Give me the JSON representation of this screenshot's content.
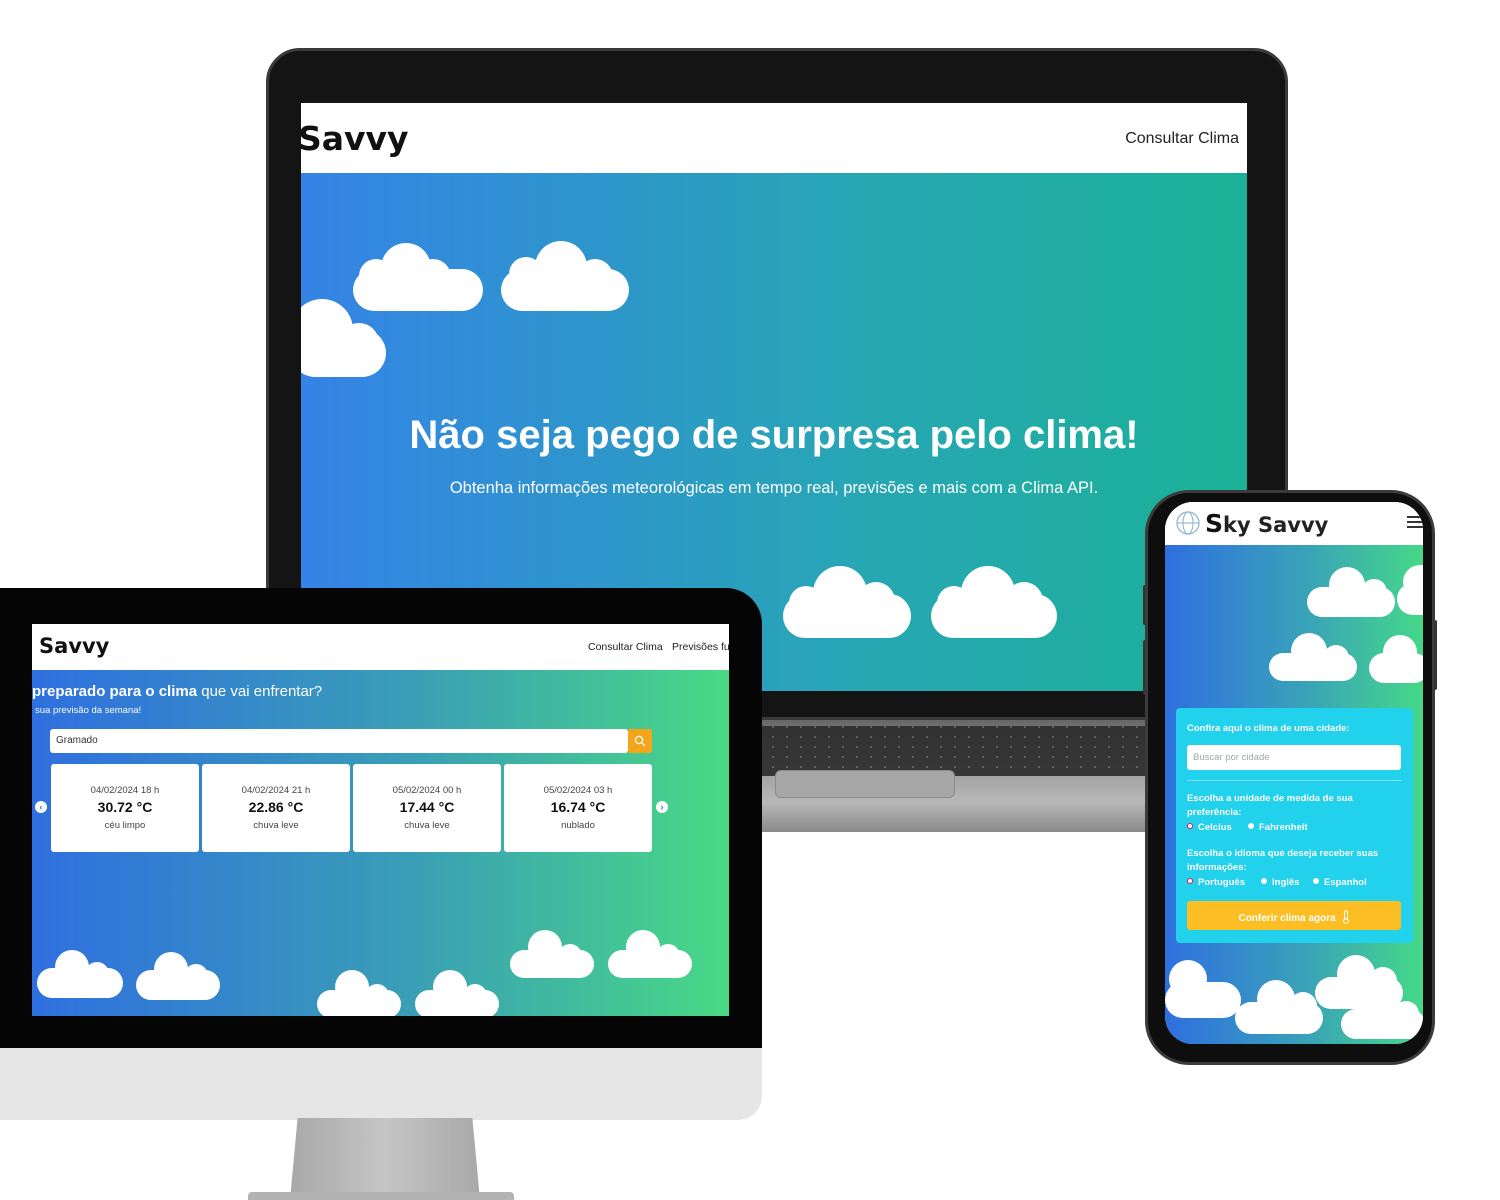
{
  "laptop": {
    "nav": {
      "logo": "Savvy",
      "link": "Consultar Clima"
    },
    "hero": {
      "title": "Não seja pego de surpresa pelo clima!",
      "subtitle": "Obtenha informações meteorológicas em tempo real, previsões e mais com a Clima API."
    }
  },
  "desktop": {
    "nav": {
      "logo": "Savvy",
      "links": [
        "Consultar Clima",
        "Previsões fu"
      ]
    },
    "hero": {
      "heading_bold": "preparado para o clima",
      "heading_rest": " que vai enfrentar?",
      "subtitle": "sua previsão da semana!"
    },
    "search": {
      "value": "Gramado"
    },
    "forecast": [
      {
        "date": "04/02/2024 18 h",
        "temp": "30.72 °C",
        "desc": "céu limpo"
      },
      {
        "date": "04/02/2024 21 h",
        "temp": "22.86 °C",
        "desc": "chuva leve"
      },
      {
        "date": "05/02/2024 00 h",
        "temp": "17.44 °C",
        "desc": "chuva leve"
      },
      {
        "date": "05/02/2024 03 h",
        "temp": "16.74 °C",
        "desc": "nublado"
      }
    ],
    "arrows": {
      "prev": "‹",
      "next": "›"
    }
  },
  "phone": {
    "nav": {
      "logo_s": "S",
      "logo_rest": "ky Savvy"
    },
    "card": {
      "title": "Confira aqui o clima de uma cidade:",
      "search_placeholder": "Buscar por cidade",
      "unit_label": "Escolha a unidade de medida de sua preferência:",
      "units": [
        "Celcius",
        "Fahrenheit"
      ],
      "lang_label": "Escolha o idioma que deseja receber suas informações:",
      "langs": [
        "Português",
        "Inglês",
        "Espanhol"
      ],
      "button": "Conferir clima agora"
    }
  },
  "colors": {
    "laptop_hero_start": "#3583e6",
    "laptop_hero_end": "#1ab197",
    "desktop_hero_end": "#48d985",
    "search_button": "#f3a51b",
    "phone_card": "#22d1ec",
    "phone_button": "#fbbf24"
  },
  "icons": [
    "search-icon",
    "globe-icon",
    "hamburger-icon",
    "thermometer-icon",
    "chevron-left-icon",
    "chevron-right-icon",
    "cloud-icon"
  ]
}
